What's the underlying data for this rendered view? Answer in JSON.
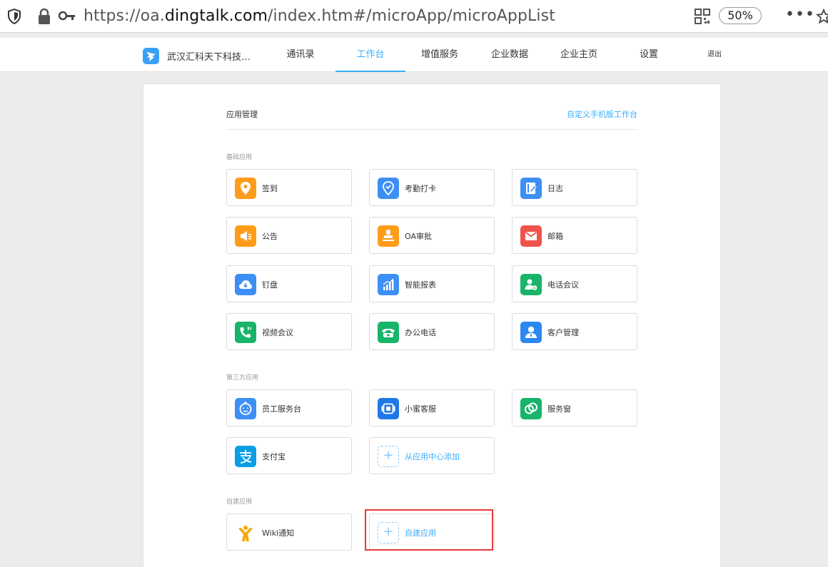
{
  "browser": {
    "url_prefix": "https://oa.",
    "url_domain": "dingtalk.com",
    "url_suffix": "/index.htm#/microApp/microAppList",
    "zoom": "50%",
    "more": "•••"
  },
  "nav": {
    "brand": "武汉汇科天下科技…",
    "items": [
      "通讯录",
      "工作台",
      "增值服务",
      "企业数据",
      "企业主页",
      "设置",
      "退出"
    ]
  },
  "page": {
    "title": "应用管理",
    "custom_link": "自定义手机版工作台"
  },
  "sections": {
    "basic": "基础应用",
    "third": "第三方应用",
    "custom": "自建应用"
  },
  "apps": {
    "signin": "签到",
    "attendance": "考勤打卡",
    "log": "日志",
    "notice": "公告",
    "oa_approval": "OA审批",
    "mail": "邮箱",
    "dingpan": "钉盘",
    "smart_report": "智能报表",
    "phone_meeting": "电话会议",
    "video_meeting": "视频会议",
    "office_phone": "办公电话",
    "customer": "客户管理",
    "staff_service": "员工服务台",
    "xiaomi_service": "小蜜客服",
    "service_window": "服务窗",
    "alipay": "支付宝",
    "add_from_center": "从应用中心添加",
    "wiki": "Wiki通知",
    "create_app": "自建应用"
  },
  "colors": {
    "accent": "#38adff",
    "orange": "#ff9c1a",
    "blue": "#3d8ff5",
    "red": "#f0534a",
    "green": "#18b46a",
    "highlight": "#e53a3a"
  }
}
